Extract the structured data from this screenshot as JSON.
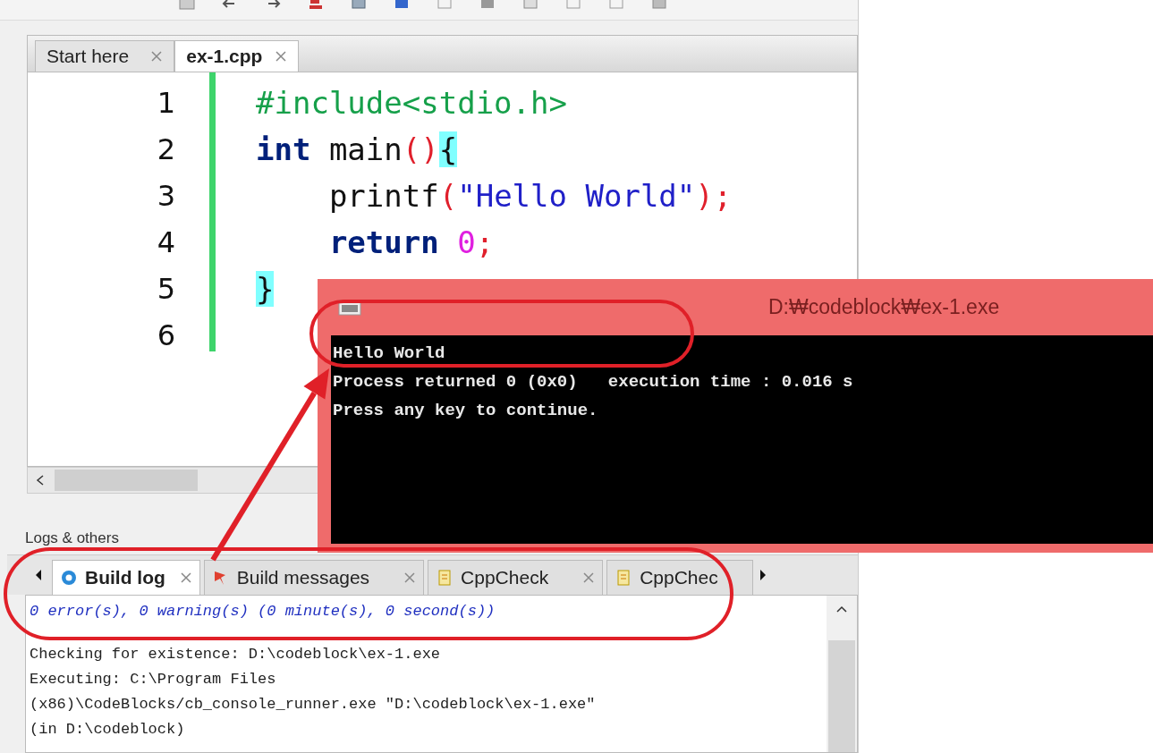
{
  "editor": {
    "tabs": [
      {
        "label": "Start here",
        "selected": false
      },
      {
        "label": "ex-1.cpp",
        "selected": true
      }
    ],
    "lines": [
      {
        "number": "1",
        "tokens": [
          {
            "text": "#include<stdio.h>",
            "kind": "preprocessor"
          }
        ]
      },
      {
        "number": "2",
        "tokens": [
          {
            "text": "int",
            "kind": "keyword"
          },
          {
            "text": " main",
            "kind": "plain"
          },
          {
            "text": "()",
            "kind": "operator"
          },
          {
            "text": "{",
            "kind": "brace_match"
          }
        ]
      },
      {
        "number": "3",
        "tokens": [
          {
            "text": "    printf",
            "kind": "plain"
          },
          {
            "text": "(",
            "kind": "operator"
          },
          {
            "text": "\"Hello World\"",
            "kind": "string"
          },
          {
            "text": ");",
            "kind": "operator"
          }
        ]
      },
      {
        "number": "4",
        "tokens": [
          {
            "text": "    return",
            "kind": "keyword"
          },
          {
            "text": " 0",
            "kind": "number"
          },
          {
            "text": ";",
            "kind": "operator"
          }
        ]
      },
      {
        "number": "5",
        "tokens": [
          {
            "text": "}",
            "kind": "brace_match"
          }
        ]
      },
      {
        "number": "6"
      }
    ]
  },
  "logs": {
    "title": "Logs & others",
    "tabs": [
      {
        "label": "Build log",
        "selected": true
      },
      {
        "label": "Build messages",
        "selected": false
      },
      {
        "label": "CppCheck",
        "selected": false
      },
      {
        "label": "CppChec",
        "selected": false
      }
    ],
    "summary": "0 error(s), 0 warning(s) (0 minute(s), 0 second(s))",
    "lines": [
      "Checking for existence: D:\\codeblock\\ex-1.exe",
      "Executing: C:\\Program Files",
      "(x86)\\CodeBlocks/cb_console_runner.exe \"D:\\codeblock\\ex-1.exe\"",
      "(in D:\\codeblock)"
    ]
  },
  "console": {
    "title": "D:₩codeblock₩ex-1.exe",
    "lines": [
      "Hello World",
      "Process returned 0 (0x0)   execution time : 0.016 s",
      "Press any key to continue."
    ]
  },
  "annotations": [
    {
      "kind": "ellipse"
    },
    {
      "kind": "ellipse"
    },
    {
      "kind": "arrow"
    }
  ]
}
